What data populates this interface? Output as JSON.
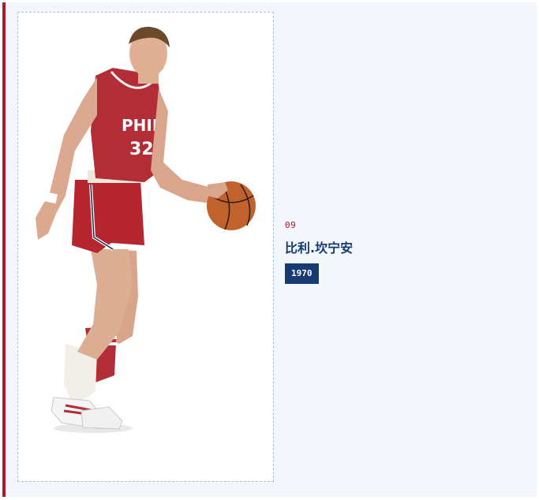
{
  "player": {
    "number": "09",
    "name": "比利.坎宁安",
    "year": "1970",
    "jersey_text": "PHILA",
    "jersey_number": "32"
  },
  "theme": {
    "accent": "#b0162c",
    "primary": "#173a73",
    "background": "#f3f6fb"
  }
}
